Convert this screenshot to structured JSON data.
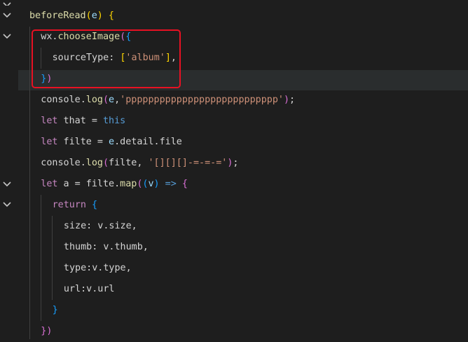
{
  "editor": {
    "lines": [
      {
        "indent": 0,
        "tokens": [
          [
            "beforeRead",
            "func"
          ],
          [
            "(",
            "br1"
          ],
          [
            "e",
            "param"
          ],
          [
            ")",
            "br1"
          ],
          [
            " {",
            "br1"
          ]
        ]
      },
      {
        "indent": 1,
        "tokens": [
          [
            "wx",
            "var"
          ],
          [
            ".",
            "var"
          ],
          [
            "chooseImage",
            "func"
          ],
          [
            "(",
            "br2"
          ],
          [
            "{",
            "br3"
          ]
        ]
      },
      {
        "indent": 2,
        "tokens": [
          [
            "sourceType",
            "prop"
          ],
          [
            ": ",
            "var"
          ],
          [
            "[",
            "br1"
          ],
          [
            "'album'",
            "str"
          ],
          [
            "]",
            "br1"
          ],
          [
            ",",
            "var"
          ]
        ]
      },
      {
        "indent": 1,
        "tokens": [
          [
            "}",
            "br3"
          ],
          [
            ")",
            "br2"
          ]
        ]
      },
      {
        "indent": 1,
        "tokens": [
          [
            "console",
            "var"
          ],
          [
            ".",
            "var"
          ],
          [
            "log",
            "func"
          ],
          [
            "(",
            "br2"
          ],
          [
            "e",
            "param"
          ],
          [
            ",",
            "var"
          ],
          [
            "'ppppppppppppppppppppppppppp'",
            "str"
          ],
          [
            ")",
            "br2"
          ],
          [
            ";",
            "var"
          ]
        ]
      },
      {
        "indent": 1,
        "tokens": [
          [
            "let",
            "kw"
          ],
          [
            " that ",
            "var"
          ],
          [
            "=",
            "var"
          ],
          [
            " ",
            "var"
          ],
          [
            "this",
            "kw2"
          ]
        ]
      },
      {
        "indent": 1,
        "tokens": [
          [
            "let",
            "kw"
          ],
          [
            " filte ",
            "var"
          ],
          [
            "=",
            "var"
          ],
          [
            " e",
            "param"
          ],
          [
            ".detail.file",
            "var"
          ]
        ]
      },
      {
        "indent": 1,
        "tokens": [
          [
            "console",
            "var"
          ],
          [
            ".",
            "var"
          ],
          [
            "log",
            "func"
          ],
          [
            "(",
            "br2"
          ],
          [
            "filte",
            "var"
          ],
          [
            ", ",
            "var"
          ],
          [
            "'[][][]-=-=-='",
            "str"
          ],
          [
            ")",
            "br2"
          ],
          [
            ";",
            "var"
          ]
        ]
      },
      {
        "indent": 1,
        "tokens": [
          [
            "let",
            "kw"
          ],
          [
            " a ",
            "var"
          ],
          [
            "=",
            "var"
          ],
          [
            " filte",
            "var"
          ],
          [
            ".",
            "var"
          ],
          [
            "map",
            "func"
          ],
          [
            "(",
            "br2"
          ],
          [
            "(",
            "br3"
          ],
          [
            "v",
            "param"
          ],
          [
            ")",
            "br3"
          ],
          [
            " => ",
            "kw2"
          ],
          [
            "{",
            "br2"
          ]
        ]
      },
      {
        "indent": 2,
        "tokens": [
          [
            "return",
            "kw"
          ],
          [
            " ",
            "var"
          ],
          [
            "{",
            "br3"
          ]
        ]
      },
      {
        "indent": 3,
        "tokens": [
          [
            "size",
            "prop"
          ],
          [
            ": v",
            "var"
          ],
          [
            ".size,",
            "var"
          ]
        ]
      },
      {
        "indent": 3,
        "tokens": [
          [
            "thumb",
            "prop"
          ],
          [
            ": v",
            "var"
          ],
          [
            ".thumb,",
            "var"
          ]
        ]
      },
      {
        "indent": 3,
        "tokens": [
          [
            "type",
            "prop"
          ],
          [
            ":v",
            "var"
          ],
          [
            ".type,",
            "var"
          ]
        ]
      },
      {
        "indent": 3,
        "tokens": [
          [
            "url",
            "prop"
          ],
          [
            ":v",
            "var"
          ],
          [
            ".url",
            "var"
          ]
        ]
      },
      {
        "indent": 2,
        "tokens": [
          [
            "}",
            "br3"
          ]
        ]
      },
      {
        "indent": 1,
        "tokens": [
          [
            "}",
            "br2"
          ],
          [
            ")",
            "br2"
          ]
        ]
      }
    ]
  }
}
